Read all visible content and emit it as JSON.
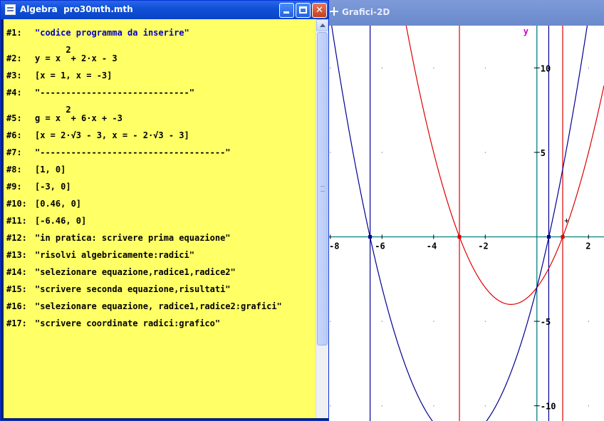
{
  "algebra_window": {
    "title": "Algebra  pro30mth.mth",
    "buttons": {
      "minimize": "",
      "maximize": "",
      "close": "✕"
    },
    "expressions": [
      {
        "label": "#1:",
        "text": "\"codice programma da inserire\"",
        "blue": true
      },
      {
        "label": "#2:",
        "text": "y = x  + 2·x - 3",
        "sup": "2",
        "blue": false
      },
      {
        "label": "#3:",
        "text": "[x = 1, x = -3]",
        "blue": false
      },
      {
        "label": "#4:",
        "text": "\"-----------------------------\"",
        "blue": false
      },
      {
        "label": "#5:",
        "text": "g = x  + 6·x + -3",
        "sup": "2",
        "blue": false
      },
      {
        "label": "#6:",
        "text": "[x = 2·√3 - 3, x = - 2·√3 - 3]",
        "blue": false
      },
      {
        "label": "#7:",
        "text": "\"------------------------------------\"",
        "blue": false
      },
      {
        "label": "#8:",
        "text": "[1, 0]",
        "blue": false
      },
      {
        "label": "#9:",
        "text": "[-3, 0]",
        "blue": false
      },
      {
        "label": "#10:",
        "text": "[0.46, 0]",
        "blue": false
      },
      {
        "label": "#11:",
        "text": "[-6.46, 0]",
        "blue": false
      },
      {
        "label": "#12:",
        "text": "\"in pratica: scrivere prima equazione\"",
        "blue": false
      },
      {
        "label": "#13:",
        "text": "\"risolvi algebricamente:radici\"",
        "blue": false
      },
      {
        "label": "#14:",
        "text": "\"selezionare equazione,radice1,radice2\"",
        "blue": false
      },
      {
        "label": "#15:",
        "text": "\"scrivere seconda equazione,risultati\"",
        "blue": false
      },
      {
        "label": "#16:",
        "text": "\"selezionare equazione, radice1,radice2:grafici\"",
        "blue": false
      },
      {
        "label": "#17:",
        "text": "\"scrivere coordinate radici:grafico\"",
        "blue": false
      }
    ]
  },
  "graph_window": {
    "title": "Grafici-2D",
    "y_axis_label": "y",
    "x_tick_labels": [
      "-8",
      "-6",
      "-4",
      "-2",
      "2"
    ],
    "y_tick_labels": [
      "10",
      "5",
      "-5",
      "-10"
    ],
    "colors": {
      "red_curve": "#e00000",
      "blue_curve": "#000090",
      "axes": "#008080",
      "y_label": "#cc00cc"
    },
    "chart_data": {
      "type": "line",
      "title": "",
      "xlabel": "",
      "ylabel": "y",
      "xlim": [
        -8.05,
        2.6
      ],
      "ylim": [
        -10.9,
        12.5
      ],
      "grid": "dots",
      "functions": [
        {
          "expr": "x^2 + 2x - 3",
          "color": "#e00000",
          "roots": [
            1,
            -3
          ]
        },
        {
          "expr": "x^2 + 6x - 3",
          "color": "#000090",
          "roots": [
            0.46,
            -6.46
          ]
        }
      ],
      "vertical_lines": [
        {
          "x": 1,
          "color": "#e00000"
        },
        {
          "x": -3,
          "color": "#e00000"
        },
        {
          "x": 0.46,
          "color": "#000090"
        },
        {
          "x": -6.46,
          "color": "#000090"
        }
      ],
      "points": [
        {
          "x": 1,
          "y": 0,
          "color": "#e00000"
        },
        {
          "x": -3,
          "y": 0,
          "color": "#e00000"
        },
        {
          "x": 0.46,
          "y": 0,
          "color": "#000090"
        },
        {
          "x": -6.46,
          "y": 0,
          "color": "#000090"
        }
      ]
    }
  }
}
